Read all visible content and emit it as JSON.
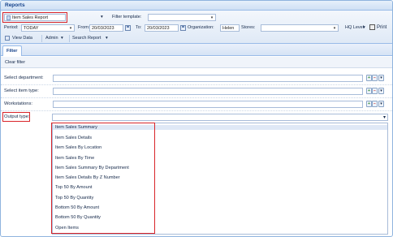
{
  "window": {
    "title": "Reports"
  },
  "toolbar": {
    "report_selected": "Item Sales Report",
    "filter_template_label": "Filter template:",
    "filter_template_value": "",
    "period_label": "Period:",
    "period_value": "TODAY",
    "from_label": "From:",
    "from_value": "20/03/2023",
    "to_label": "To:",
    "to_value": "20/03/2023",
    "organization_label": "Organization:",
    "organization_value": "Helen",
    "stores_label": "Stores:",
    "stores_value": "",
    "hq_level_label": "HQ Level",
    "print_label": "Print",
    "view_data_label": "View Data",
    "admin_label": "Admin",
    "search_report_label": "Search Report"
  },
  "filter_panel": {
    "tab_label": "Filter",
    "clear_filter_label": "Clear filter",
    "rows": [
      {
        "label": "Select department:"
      },
      {
        "label": "Select item type:"
      },
      {
        "label": "Workstations:"
      },
      {
        "label": "Output type:"
      }
    ]
  },
  "output_type_options": [
    "Item Sales Summary",
    "Item Sales Details",
    "Item Sales By Location",
    "Item Sales By Time",
    "Item Sales Summary By Department",
    "Item Sales Details By Z Number",
    "Top 50 By Amount",
    "Top 50 By Quantity",
    "Bottom 50 By Amount",
    "Bottom 50 By Quantity",
    "Open Items"
  ],
  "colors": {
    "highlight": "#d9252a",
    "header_blue": "#15428b"
  }
}
